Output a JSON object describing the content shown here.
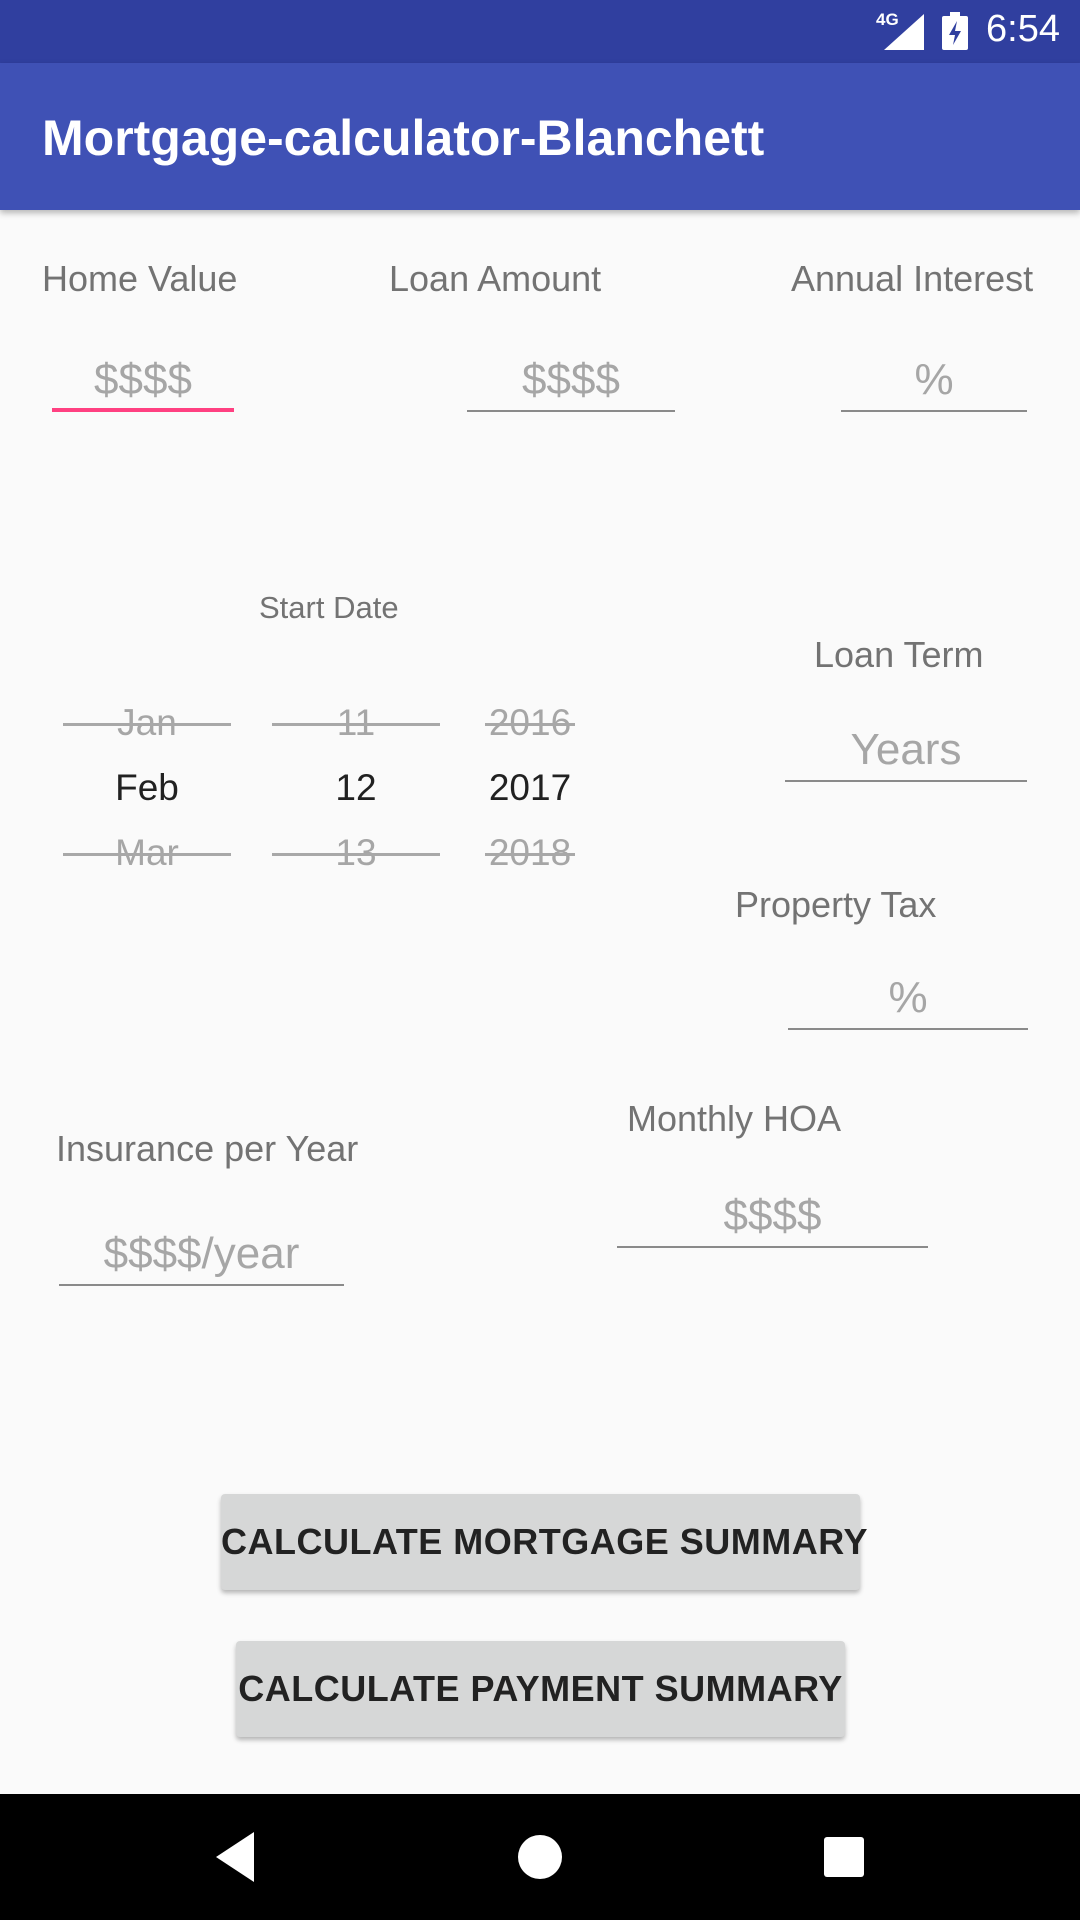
{
  "status_bar": {
    "network": "4G",
    "time": "6:54",
    "icons": [
      "signal-icon",
      "battery-icon"
    ]
  },
  "app_bar": {
    "title": "Mortgage-calculator-Blanchett",
    "color": "#3f51b5",
    "status_color": "#303f9f"
  },
  "home_value": {
    "label": "Home Value",
    "placeholder": "$$$$",
    "focused": true
  },
  "loan_amount": {
    "label": "Loan Amount",
    "placeholder": "$$$$"
  },
  "annual_interest": {
    "label": "Annual Interest",
    "placeholder": "%"
  },
  "start_date": {
    "label": "Start Date",
    "months": {
      "prev": "Jan",
      "selected": "Feb",
      "next": "Mar"
    },
    "days": {
      "prev": "11",
      "selected": "12",
      "next": "13"
    },
    "years": {
      "prev": "2016",
      "selected": "2017",
      "next": "2018"
    }
  },
  "loan_term": {
    "label": "Loan Term",
    "placeholder": "Years"
  },
  "property_tax": {
    "label": "Property Tax",
    "placeholder": "%"
  },
  "monthly_hoa": {
    "label": "Monthly HOA",
    "placeholder": "$$$$"
  },
  "insurance": {
    "label": "Insurance per Year",
    "placeholder": "$$$$/year"
  },
  "buttons": {
    "mortgage_summary": "CALCULATE MORTGAGE SUMMARY",
    "payment_summary": "CALCULATE PAYMENT SUMMARY"
  },
  "accent_color": "#ff4081",
  "nav_bar": {
    "icons": [
      "back-icon",
      "home-icon",
      "recents-icon"
    ]
  }
}
